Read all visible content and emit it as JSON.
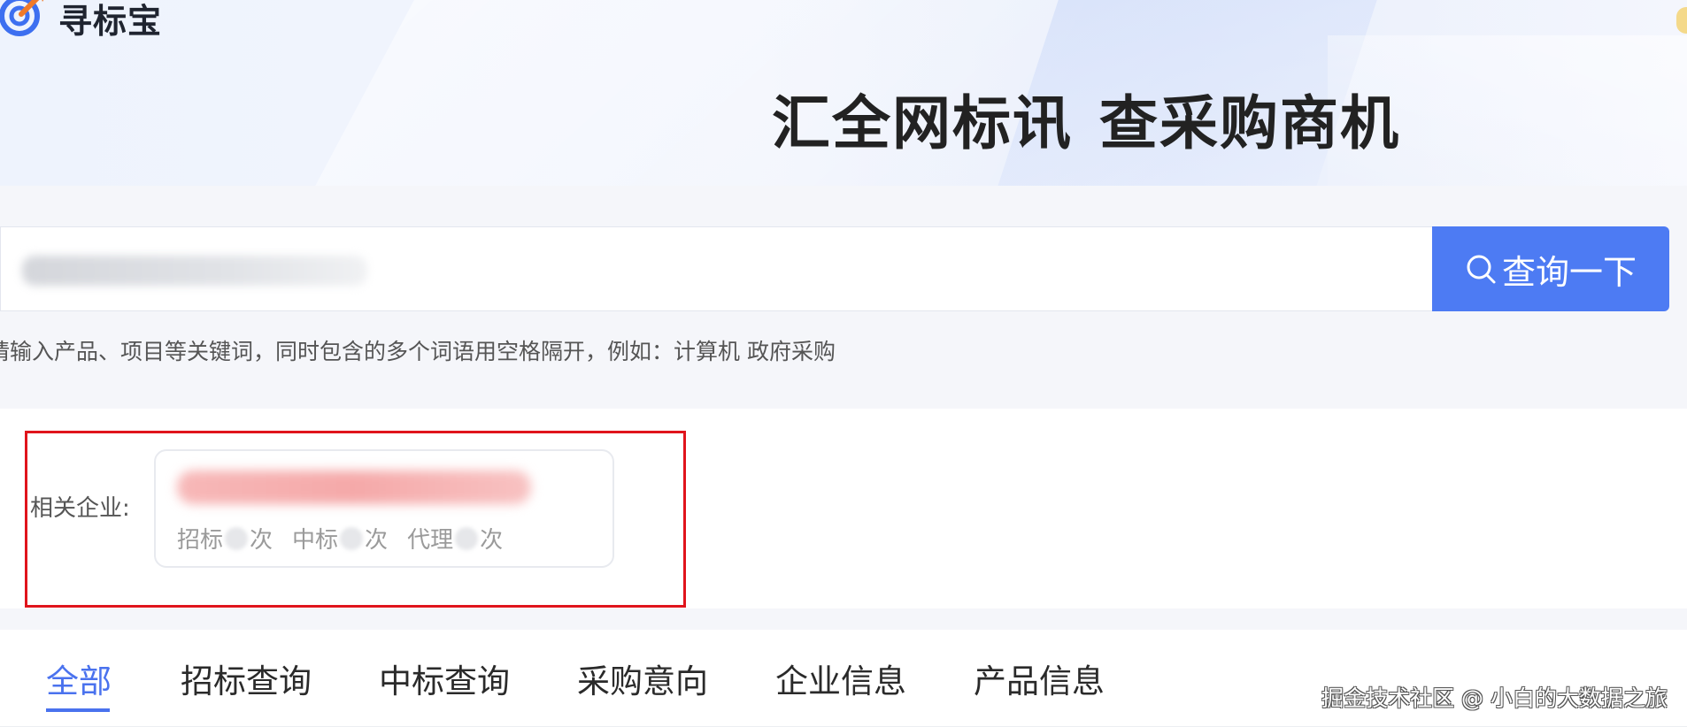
{
  "brand": {
    "name": "寻标宝"
  },
  "banner": {
    "slogan_part1": "汇全网标讯",
    "slogan_part2": "查采购商机"
  },
  "search": {
    "button_label": "查询一下",
    "hint": "请输入产品、项目等关键词，同时包含的多个词语用空格隔开，例如：计算机 政府采购"
  },
  "company": {
    "label": "相关企业:",
    "stats": [
      {
        "prefix": "招标",
        "suffix": "次"
      },
      {
        "prefix": "中标",
        "suffix": "次"
      },
      {
        "prefix": "代理",
        "suffix": "次"
      }
    ]
  },
  "tabs": [
    "全部",
    "招标查询",
    "中标查询",
    "采购意向",
    "企业信息",
    "产品信息"
  ],
  "active_tab": "全部",
  "watermark": "掘金技术社区 @ 小白的大数据之旅",
  "colors": {
    "accent": "#4d7bf3",
    "highlight_border": "#e0141c"
  }
}
